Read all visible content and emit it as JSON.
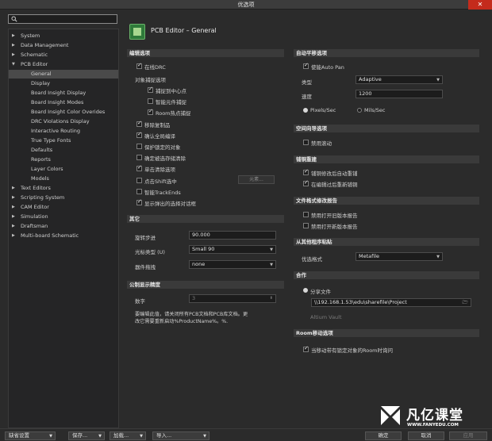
{
  "window": {
    "title": "优选项",
    "close_glyph": "✕"
  },
  "search": {
    "placeholder": "",
    "icon": "search-icon"
  },
  "tree": [
    {
      "label": "System",
      "arrow": "▶",
      "level": 0
    },
    {
      "label": "Data Management",
      "arrow": "▶",
      "level": 0
    },
    {
      "label": "Schematic",
      "arrow": "▶",
      "level": 0
    },
    {
      "label": "PCB Editor",
      "arrow": "▼",
      "level": 0
    },
    {
      "label": "General",
      "arrow": "",
      "level": 1,
      "selected": true
    },
    {
      "label": "Display",
      "arrow": "",
      "level": 1
    },
    {
      "label": "Board Insight Display",
      "arrow": "",
      "level": 1
    },
    {
      "label": "Board Insight Modes",
      "arrow": "",
      "level": 1
    },
    {
      "label": "Board Insight Color Overides",
      "arrow": "",
      "level": 1
    },
    {
      "label": "DRC Violations Display",
      "arrow": "",
      "level": 1
    },
    {
      "label": "Interactive Routing",
      "arrow": "",
      "level": 1
    },
    {
      "label": "True Type Fonts",
      "arrow": "",
      "level": 1
    },
    {
      "label": "Defaults",
      "arrow": "",
      "level": 1
    },
    {
      "label": "Reports",
      "arrow": "",
      "level": 1
    },
    {
      "label": "Layer Colors",
      "arrow": "",
      "level": 1
    },
    {
      "label": "Models",
      "arrow": "",
      "level": 1
    },
    {
      "label": "Text Editors",
      "arrow": "▶",
      "level": 0
    },
    {
      "label": "Scripting System",
      "arrow": "▶",
      "level": 0
    },
    {
      "label": "CAM Editor",
      "arrow": "▶",
      "level": 0
    },
    {
      "label": "Simulation",
      "arrow": "▶",
      "level": 0
    },
    {
      "label": "Draftsman",
      "arrow": "▶",
      "level": 0
    },
    {
      "label": "Multi-board Schematic",
      "arrow": "▶",
      "level": 0
    }
  ],
  "header": {
    "title": "PCB Editor – General",
    "icon": "pcb-board-icon"
  },
  "editing": {
    "title": "编辑选项",
    "online_drc": {
      "label": "在线DRC",
      "checked": true
    },
    "snap_label": "对象捕捉选项",
    "snap_center": {
      "label": "捕捉到中心点",
      "checked": true
    },
    "smart_comp": {
      "label": "智能元件捕捉",
      "checked": false
    },
    "room_hotspot": {
      "label": "Room热点捕捉",
      "checked": true
    },
    "remove_dup": {
      "label": "移除复制品",
      "checked": true
    },
    "confirm_global": {
      "label": "确认全局编译",
      "checked": true
    },
    "protect_locked": {
      "label": "保护锁定的对象",
      "checked": false
    },
    "confirm_sel_clear": {
      "label": "确定被选存储清除",
      "checked": false
    },
    "click_clear": {
      "label": "单击清除选项",
      "checked": true
    },
    "shift_click": {
      "label": "点击Shift选中",
      "checked": false
    },
    "primitives_btn": "元素...",
    "smart_track": {
      "label": "智能TrackEnds",
      "checked": false
    },
    "popup_filter": {
      "label": "显示弹出的选择对话框",
      "checked": true
    }
  },
  "other": {
    "title": "其它",
    "rotation_label": "旋转步进",
    "rotation_value": "90.000",
    "cursor_label": "光标类型 (U)",
    "cursor_value": "Small 90",
    "drag_label": "器件拖拽",
    "drag_value": "none"
  },
  "metric": {
    "title": "公制显示精度",
    "digits_label": "数字",
    "digits_value": "3",
    "note_line1": "要编辑此值，请关闭所有PCB文档和PCB库文档。更",
    "note_line2": "改它需要重新启动%ProductName%。%."
  },
  "autopan": {
    "title": "自动平移选项",
    "enable": {
      "label": "使能Auto Pan",
      "checked": true
    },
    "style_label": "类型",
    "style_value": "Adaptive",
    "speed_label": "速度",
    "speed_value": "1200",
    "pixels_label": "Pixels/Sec",
    "mils_label": "Mils/Sec",
    "pixels_selected": true
  },
  "space_nav": {
    "title": "空间向导选项",
    "disable_roll": {
      "label": "禁用滚动",
      "checked": false
    }
  },
  "polygon": {
    "title": "铺铜重建",
    "repour_modify": {
      "label": "铺铜修改后自动重铺",
      "checked": true
    },
    "repour_edit": {
      "label": "在编辑过后重新铺铜",
      "checked": true
    }
  },
  "file_format": {
    "title": "文件格式修改报告",
    "disable_old": {
      "label": "禁用打开旧版本报告",
      "checked": false
    },
    "disable_new": {
      "label": "禁用打开新版本报告",
      "checked": false
    }
  },
  "paste": {
    "title": "从其他程序粘贴",
    "pref_label": "优选格式",
    "pref_value": "Metafile"
  },
  "collab": {
    "title": "合作",
    "shared_label": "分享文件",
    "path": "\\\\192.168.1.53\\edu\\sharefile\\Project",
    "vault_label": "Altium Vault"
  },
  "room_move": {
    "title": "Room移动选项",
    "ask": {
      "label": "当移动带有锁定对象的Room时询问",
      "checked": true
    }
  },
  "footer": {
    "default_btn": "缺省设置",
    "save_btn": "保存...",
    "load_btn": "加载...",
    "import_btn": "导入...",
    "ok_btn": "确定",
    "cancel_btn": "取消",
    "apply_btn": "应用"
  },
  "watermark": {
    "title": "凡亿课堂",
    "url": "WWW.FANYEDU.COM"
  }
}
